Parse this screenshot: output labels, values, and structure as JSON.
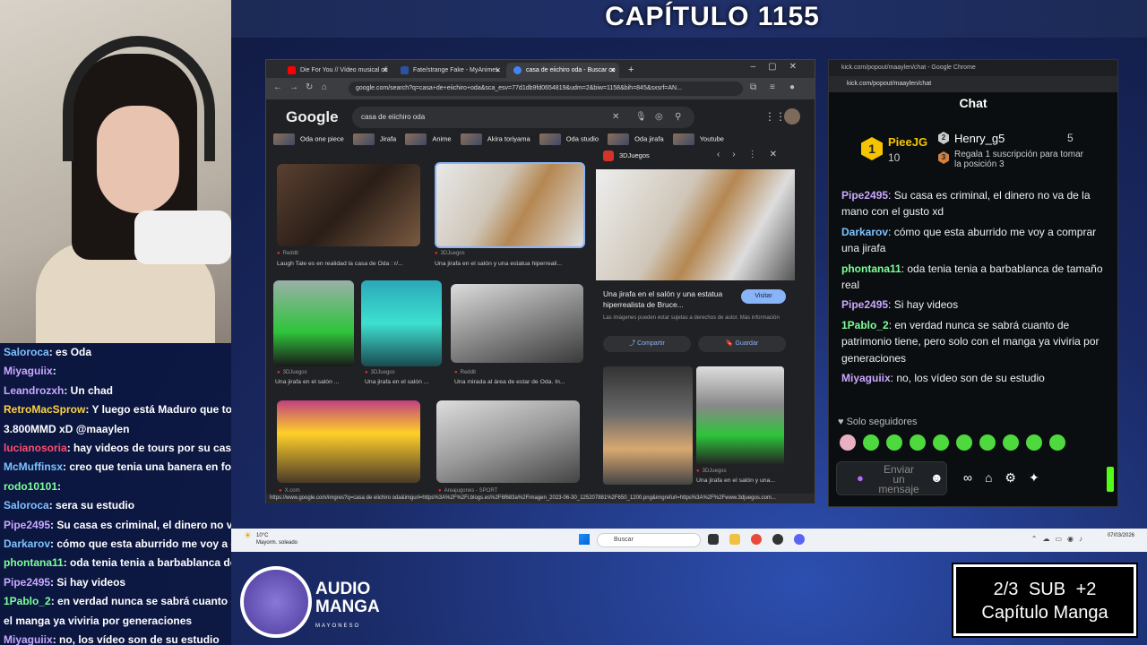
{
  "title": "CAPÍTULO 1155",
  "left_chat": [
    {
      "user": "Saloroca",
      "color": "#7ec3ff",
      "text": ": es Oda"
    },
    {
      "user": "Miyaguiix",
      "color": "#c9a8ff",
      "text": ": "
    },
    {
      "user": "Leandrozxh",
      "color": "#c9a8ff",
      "text": ": Un chad"
    },
    {
      "user": "RetroMacSprow",
      "color": "#ffd23f",
      "text": ": Y luego está Maduro que todo"
    },
    {
      "user": "",
      "color": "#fff",
      "text": "3.800MMD xD @maaylen"
    },
    {
      "user": "lucianosoria",
      "color": "#ff4d6d",
      "text": ": hay videos de tours por su casa"
    },
    {
      "user": "McMuffinsx",
      "color": "#7ec3ff",
      "text": ": creo que tenia una banera en fo"
    },
    {
      "user": "rodo10101",
      "color": "#7dff9a",
      "text": ": "
    },
    {
      "user": "Saloroca",
      "color": "#7ec3ff",
      "text": ": sera su estudio"
    },
    {
      "user": "Pipe2495",
      "color": "#c9a8ff",
      "text": ": Su casa es criminal, el dinero no v"
    },
    {
      "user": "Darkarov",
      "color": "#7ec3ff",
      "text": ": cómo que esta aburrido me voy a co"
    },
    {
      "user": "phontana11",
      "color": "#7dff9a",
      "text": ": oda tenia tenia a barbablanca de t"
    },
    {
      "user": "Pipe2495",
      "color": "#c9a8ff",
      "text": ": Si hay videos"
    },
    {
      "user": "1Pablo_2",
      "color": "#7dff9a",
      "text": ": en verdad nunca se sabrá cuanto de"
    },
    {
      "user": "",
      "color": "#fff",
      "text": "el manga ya viviria por generaciones"
    },
    {
      "user": "Miyaguiix",
      "color": "#c9a8ff",
      "text": ": no, los vídeo son de su estudio"
    }
  ],
  "browser": {
    "tabs": [
      {
        "label": "Die For You // Vídeo musical ofi",
        "fav": "#ff0000"
      },
      {
        "label": "Fate/strange Fake - MyAnimeL",
        "fav": "#2e51a2"
      },
      {
        "label": "casa de eiichiro oda - Buscar co",
        "fav": "#4285f4"
      }
    ],
    "url": "google.com/search?q=casa+de+eiichiro+oda&sca_esv=77d1db9fd0654819&udm=2&biw=1158&bih=845&sxsrf=AN...",
    "logo": "Google",
    "query": "casa de eiichiro oda",
    "chips": [
      "Oda one piece",
      "Jirafa",
      "Anime",
      "Akira toriyama",
      "Oda studio",
      "Oda jirafa",
      "Youtube"
    ],
    "results": [
      {
        "source": "Reddit",
        "caption": "Laugh Tale es en realidad la casa de Oda : r/..."
      },
      {
        "source": "3DJuegos",
        "caption": "Una jirafa en el salón y una estatua hiperreali..."
      },
      {
        "source": "3DJuegos",
        "caption": "Una jirafa en el salón ..."
      },
      {
        "source": "3DJuegos",
        "caption": "Una jirafa en el salón ..."
      },
      {
        "source": "Reddit",
        "caption": "Una mirada al área de estar de Oda. In..."
      },
      {
        "source": "X.com",
        "caption": ""
      },
      {
        "source": "Areajugones - SPORT",
        "caption": ""
      }
    ],
    "preview": {
      "source": "3DJuegos",
      "title": "Una jirafa en el salón y una estatua hiperrealista de Bruce...",
      "visit": "Visitar",
      "notice": "Las imágenes pueden estar sujetas a derechos de autor. Más información",
      "share": "Compartir",
      "save": "Guardar",
      "related_source": "3DJuegos",
      "related_caption": "Una jirafa en el salón y una..."
    },
    "status_url": "https://www.google.com/imgres?q=casa de eiichiro oda&imgurl=https%3A%2F%2Fi.blogs.es%2F6f683a%2Fimagen_2023-06-30_125207881%2F650_1200.png&imgrefurl=https%3A%2F%2Fwww.3djuegos.com..."
  },
  "kick": {
    "window_title": "kick.com/popout/maaylen/chat - Google Chrome",
    "url": "kick.com/popout/maaylen/chat",
    "header": "Chat",
    "leader1": {
      "rank": "1",
      "name": "PieeJG",
      "count": "10"
    },
    "leader2": {
      "rank": "2",
      "name": "Henry_g5",
      "count": "5"
    },
    "leader3": {
      "rank": "3",
      "text": "Regala 1 suscripción para tomar la posición 3"
    },
    "messages": [
      {
        "user": "Pipe2495",
        "color": "#c9a8ff",
        "text": ": Su casa es criminal, el dinero no va de la mano con el gusto xd"
      },
      {
        "user": "Darkarov",
        "color": "#7ec3ff",
        "text": ": cómo que esta aburrido me voy a comprar una jirafa"
      },
      {
        "user": "phontana11",
        "color": "#7dff9a",
        "text": ": oda tenia tenia a barbablanca de tamaño real"
      },
      {
        "user": "Pipe2495",
        "color": "#c9a8ff",
        "text": ": Si hay videos"
      },
      {
        "user": "1Pablo_2",
        "color": "#7dff9a",
        "text": ": en verdad nunca se sabrá cuanto de patrimonio tiene, pero solo con el manga ya viviria por generaciones"
      },
      {
        "user": "Miyaguiix",
        "color": "#c9a8ff",
        "text": ": no, los vídeo son de su estudio"
      }
    ],
    "followers_only": "Solo seguidores",
    "input_placeholder": "Enviar un mensaje"
  },
  "taskbar": {
    "weather_temp": "10°C",
    "weather_desc": "Mayorm. soleado",
    "search_label": "Buscar",
    "date": "07/03/2026"
  },
  "logo_text": {
    "line1": "AUDIO",
    "line2": "MANGA",
    "sub": "MAYONESO"
  },
  "subbox": {
    "line1": "2/3 SUB   +2",
    "line2": "Capítulo Manga"
  }
}
